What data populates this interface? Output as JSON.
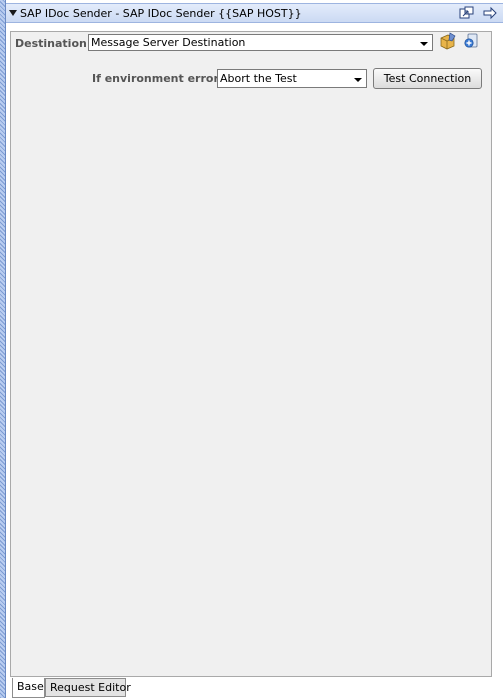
{
  "header": {
    "title": "SAP IDoc Sender - SAP IDoc Sender {{SAP HOST}}",
    "icons": [
      "maximize-icon",
      "pin-arrow-icon"
    ]
  },
  "form": {
    "destination_label": "Destination:",
    "destination_value": "Message Server Destination",
    "env_error_label": "If environment error:",
    "env_error_value": "Abort the Test",
    "test_connection_label": "Test Connection",
    "icons": [
      "edit-destination-icon",
      "add-destination-icon"
    ]
  },
  "tabs": [
    {
      "label": "Base",
      "active": true
    },
    {
      "label": "Request Editor",
      "active": false
    }
  ],
  "colors": {
    "header_bg": "#cbdaf3",
    "panel_bg": "#f0f0f0",
    "label_text": "#555555"
  }
}
